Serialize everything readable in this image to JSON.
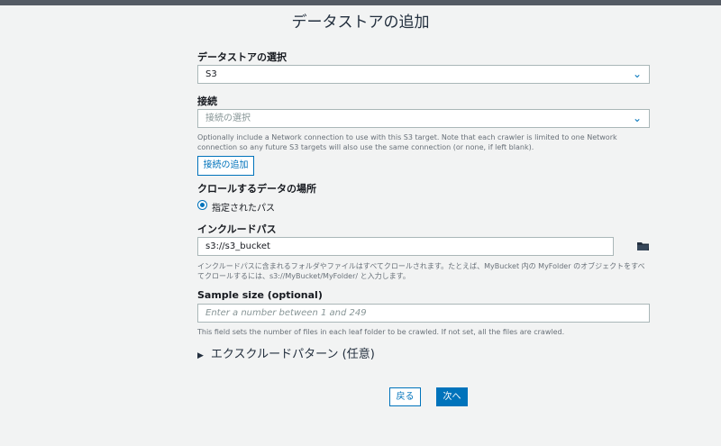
{
  "title": "データストアの追加",
  "datastore": {
    "label": "データストアの選択",
    "value": "S3"
  },
  "connection": {
    "label": "接続",
    "placeholder": "接続の選択",
    "help": "Optionally include a Network connection to use with this S3 target. Note that each crawler is limited to one Network connection so any future S3 targets will also use the same connection (or none, if left blank).",
    "add_button": "接続の追加"
  },
  "crawl_location": {
    "label": "クロールするデータの場所",
    "option": "指定されたパス"
  },
  "include_path": {
    "label": "インクルードパス",
    "value": "s3://s3_bucket",
    "help": "インクルードパスに含まれるフォルダやファイルはすべてクロールされます。たとえば、MyBucket 内の MyFolder のオブジェクトをすべてクロールするには、s3://MyBucket/MyFolder/ と入力します。"
  },
  "sample_size": {
    "label": "Sample size (optional)",
    "placeholder": "Enter a number between 1 and 249",
    "help": "This field sets the number of files in each leaf folder to be crawled. If not set, all the files are crawled."
  },
  "exclude_patterns": {
    "label": "エクスクルードパターン (任意)"
  },
  "footer": {
    "back": "戻る",
    "next": "次へ"
  },
  "icons": {
    "chevron": "chevron-down-icon",
    "folder": "folder-icon",
    "caret": "caret-right-icon"
  },
  "colors": {
    "accent": "#0073bb",
    "background": "#f2f3f3"
  }
}
